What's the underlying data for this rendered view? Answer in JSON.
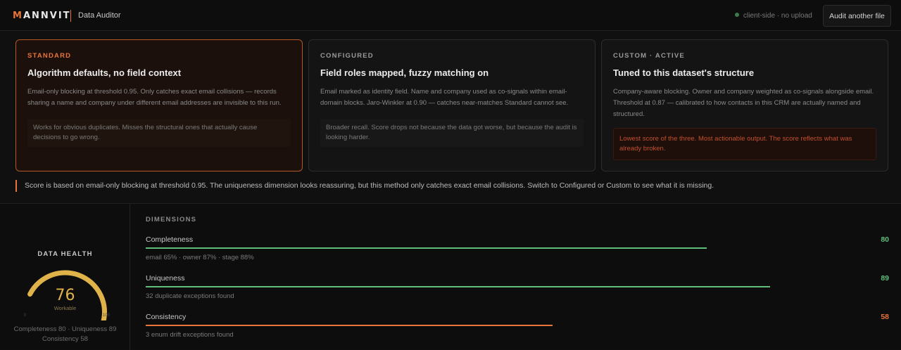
{
  "header": {
    "brand_prefix": "M",
    "brand_rest": "ANNVIT",
    "app_name": "Data Auditor",
    "status": "client-side · no upload",
    "audit_button": "Audit another file"
  },
  "cards": [
    {
      "tag": "STANDARD",
      "title": "Algorithm defaults, no field context",
      "description": "Email-only blocking at threshold 0.95. Only catches exact email collisions — records sharing a name and company under different email addresses are invisible to this run.",
      "note": "Works for obvious duplicates. Misses the structural ones that actually cause decisions to go wrong."
    },
    {
      "tag": "CONFIGURED",
      "title": "Field roles mapped, fuzzy matching on",
      "description": "Email marked as identity field. Name and company used as co-signals within email-domain blocks. Jaro-Winkler at 0.90 — catches near-matches Standard cannot see.",
      "note": "Broader recall. Score drops not because the data got worse, but because the audit is looking harder."
    },
    {
      "tag": "CUSTOM · ACTIVE",
      "title": "Tuned to this dataset's structure",
      "description": "Company-aware blocking. Owner and company weighted as co-signals alongside email. Threshold at 0.87 — calibrated to how contacts in this CRM are actually named and structured.",
      "note": "Lowest score of the three. Most actionable output. The score reflects what was already broken."
    }
  ],
  "banner": "Score is based on email-only blocking at threshold 0.95. The uniqueness dimension looks reassuring, but this method only catches exact email collisions. Switch to Configured or Custom to see what it is missing.",
  "health": {
    "title": "DATA HEALTH",
    "score": "76",
    "score_value": 76,
    "label": "Workable",
    "min": "0",
    "max": "100",
    "summary_line1": "Completeness 80 · Uniqueness 89",
    "summary_line2": "Consistency 58",
    "gauge_color": "#e0b34a",
    "track_color": "#2a2a2a"
  },
  "dimensions": {
    "title": "DIMENSIONS",
    "items": [
      {
        "name": "Completeness",
        "value": "80",
        "score": 80,
        "detail": "email 65% · owner 87% · stage 88%",
        "color": "#5fbf7a"
      },
      {
        "name": "Uniqueness",
        "value": "89",
        "score": 89,
        "detail": "32 duplicate exceptions found",
        "color": "#5fbf7a"
      },
      {
        "name": "Consistency",
        "value": "58",
        "score": 58,
        "detail": "3 enum drift exceptions found",
        "color": "#e8743b"
      }
    ]
  }
}
